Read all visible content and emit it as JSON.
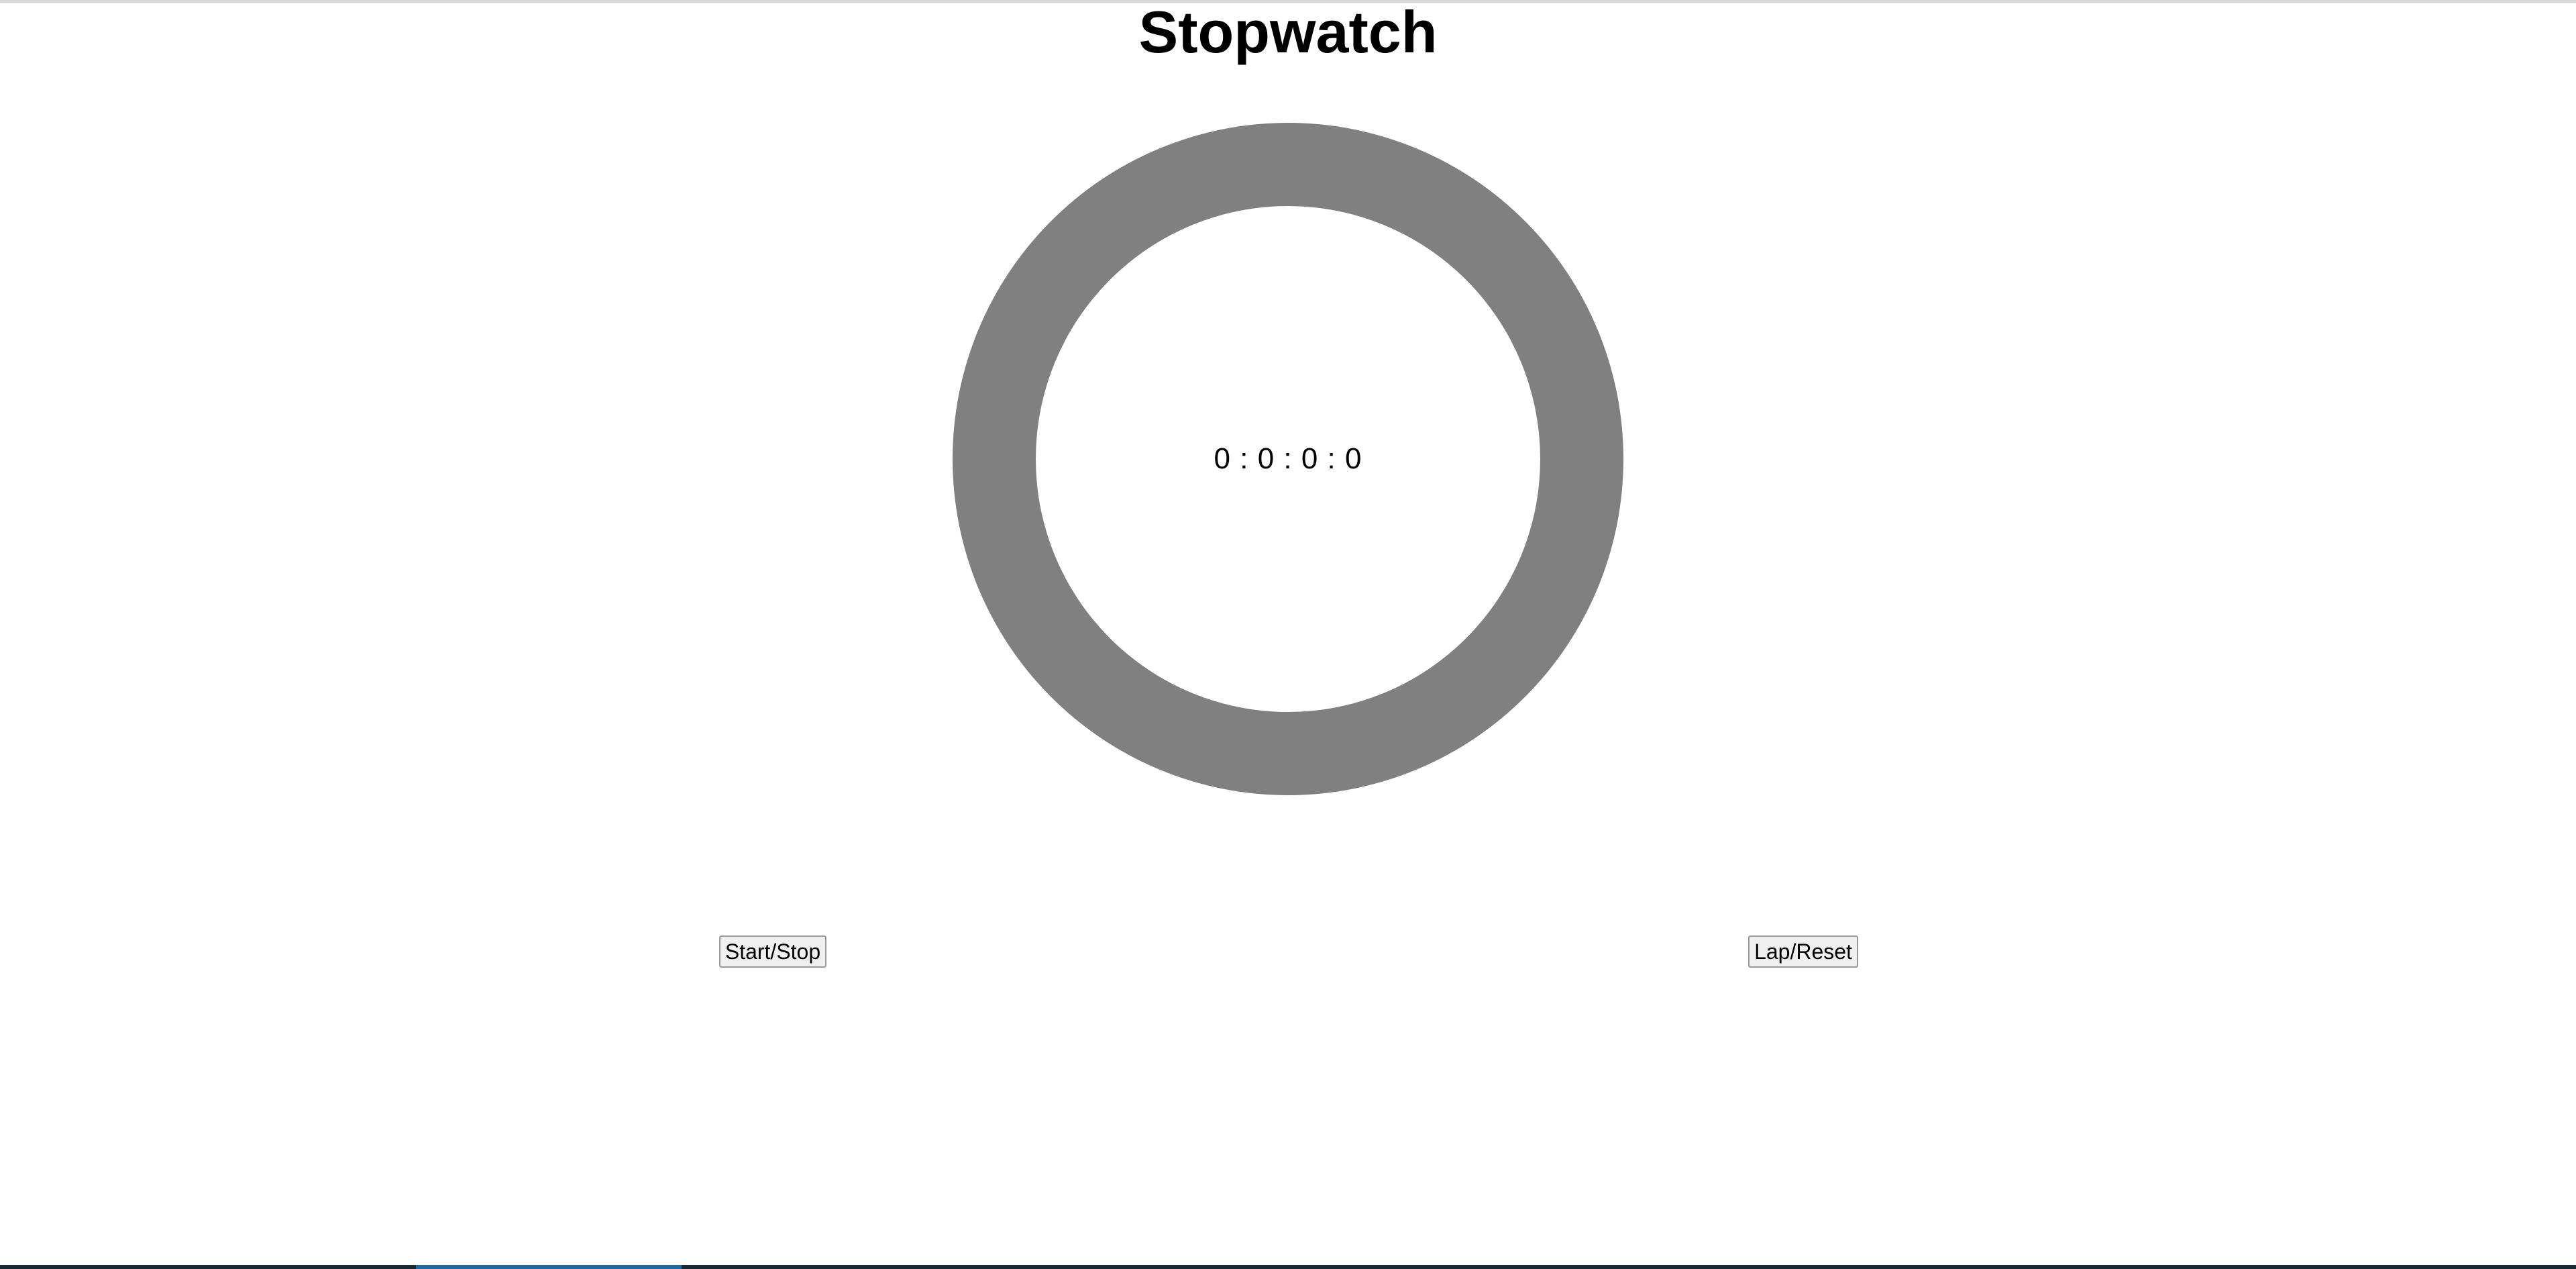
{
  "page": {
    "title": "Stopwatch"
  },
  "stopwatch": {
    "display": "0 : 0 : 0 : 0",
    "ring_color": "#808080"
  },
  "controls": {
    "start_stop_label": "Start/Stop",
    "lap_reset_label": "Lap/Reset"
  }
}
